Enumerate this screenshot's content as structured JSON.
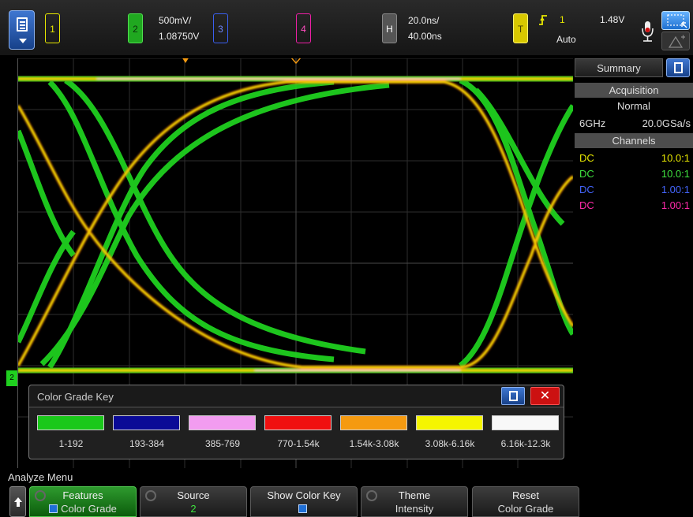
{
  "topbar": {
    "menu_icon": "document-menu-icon",
    "ch1": "1",
    "ch2": "2",
    "ch3": "3",
    "ch4": "4",
    "vscale": "500mV/",
    "voffset": "1.08750V",
    "h_label": "H",
    "tscale": "20.0ns/",
    "tdelay": "40.00ns",
    "t_label": "T",
    "trig_source": "1",
    "trig_level": "1.48V",
    "trig_mode": "Auto",
    "trig_icon": "rising-edge-icon",
    "mic_icon": "microphone-icon",
    "pointer_icon": "pointer-icon",
    "zoom_icon": "zoom-icon"
  },
  "grid": {
    "ground_marker": "2"
  },
  "sidebar": {
    "tab": "Summary",
    "acquisition_title": "Acquisition",
    "acq_mode": "Normal",
    "bandwidth": "6GHz",
    "sample_rate": "20.0GSa/s",
    "channels_title": "Channels",
    "channels": [
      {
        "coupling": "DC",
        "probe": "10.0:1",
        "color": "#e8e800"
      },
      {
        "coupling": "DC",
        "probe": "10.0:1",
        "color": "#3fe23f"
      },
      {
        "coupling": "DC",
        "probe": "1.00:1",
        "color": "#4466ff"
      },
      {
        "coupling": "DC",
        "probe": "1.00:1",
        "color": "#ff2aaa"
      }
    ]
  },
  "color_key": {
    "title": "Color Grade Key",
    "menu_icon": "document-menu-icon",
    "close_icon": "close-icon",
    "close_glyph": "✕",
    "bins": [
      {
        "label": "1-192",
        "color": "#1ac81a"
      },
      {
        "label": "193-384",
        "color": "#0a0a96"
      },
      {
        "label": "385-769",
        "color": "#f29cf0"
      },
      {
        "label": "770-1.54k",
        "color": "#f01010"
      },
      {
        "label": "1.54k-3.08k",
        "color": "#f59a10"
      },
      {
        "label": "3.08k-6.16k",
        "color": "#f5f500"
      },
      {
        "label": "6.16k-12.3k",
        "color": "#f8f8f8"
      }
    ]
  },
  "bottom": {
    "menu_name": "Analyze Menu",
    "up_icon": "up-arrow-icon",
    "softkeys": [
      {
        "top": "Features",
        "bottom": "Color Grade",
        "checkbox": true,
        "active": true
      },
      {
        "top": "Source",
        "bottom": "2",
        "checkbox": false,
        "active": false
      },
      {
        "top": "Show Color Key",
        "bottom": "",
        "checkbox": true,
        "active": false
      },
      {
        "top": "Theme",
        "bottom": "Intensity",
        "checkbox": false,
        "active": false
      },
      {
        "top": "Reset",
        "bottom": "Color Grade",
        "checkbox": false,
        "active": false
      }
    ]
  }
}
